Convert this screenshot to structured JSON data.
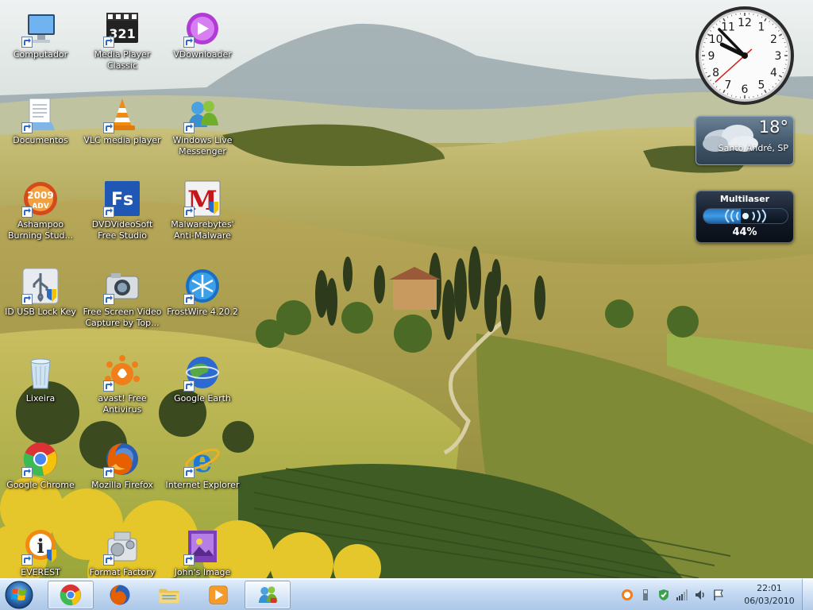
{
  "desktop": {
    "icons": [
      {
        "label": "Computador",
        "icon": "computer-icon"
      },
      {
        "label": "Media Player Classic",
        "icon": "media-player-classic-icon"
      },
      {
        "label": "VDownloader",
        "icon": "vdownloader-icon"
      },
      {
        "label": "Documentos",
        "icon": "documents-icon"
      },
      {
        "label": "VLC media player",
        "icon": "vlc-icon"
      },
      {
        "label": "Windows Live Messenger",
        "icon": "messenger-icon"
      },
      {
        "label": "Ashampoo Burning Stud...",
        "icon": "ashampoo-icon",
        "badge": "2009",
        "badge2": "ADV"
      },
      {
        "label": "DVDVideoSoft Free Studio",
        "icon": "dvdvideosoft-icon",
        "badge": "Fs"
      },
      {
        "label": "Malwarebytes' Anti-Malware",
        "icon": "malwarebytes-icon",
        "badge": "M"
      },
      {
        "label": "ID USB Lock Key",
        "icon": "usb-lock-icon"
      },
      {
        "label": "Free Screen Video Capture by Top...",
        "icon": "camera-icon"
      },
      {
        "label": "FrostWire 4.20.2",
        "icon": "frostwire-icon"
      },
      {
        "label": "Lixeira",
        "icon": "recycle-bin-icon"
      },
      {
        "label": "avast! Free Antivirus",
        "icon": "avast-icon"
      },
      {
        "label": "Google Earth",
        "icon": "google-earth-icon"
      },
      {
        "label": "Google Chrome",
        "icon": "chrome-icon"
      },
      {
        "label": "Mozilla Firefox",
        "icon": "firefox-icon"
      },
      {
        "label": "Internet Explorer",
        "icon": "internet-explorer-icon",
        "badge": "e"
      },
      {
        "label": "EVEREST Ultimate",
        "icon": "everest-icon",
        "badge": "i"
      },
      {
        "label": "Format Factory",
        "icon": "format-factory-icon"
      },
      {
        "label": "John's Image",
        "icon": "image-icon"
      }
    ]
  },
  "gadgets": {
    "clock": {
      "hour": 9,
      "minute": 52,
      "second": 38,
      "numerals": [
        "12",
        "1",
        "2",
        "3",
        "4",
        "5",
        "6",
        "7",
        "8",
        "9",
        "10",
        "11"
      ]
    },
    "weather": {
      "temperature": "18°",
      "city": "Santo André, SP"
    },
    "network": {
      "name": "Multilaser",
      "percent": "44%",
      "level": 0.44
    }
  },
  "taskbar": {
    "start_icon": "windows-logo-icon",
    "pinned": [
      "chrome-icon",
      "firefox-icon",
      "explorer-icon",
      "media-player-icon",
      "messenger-icon"
    ],
    "tray_icons": [
      "avast-tray-icon",
      "usb-tray-icon",
      "security-tray-icon",
      "signal-tray-icon",
      "volume-tray-icon",
      "action-center-flag-icon"
    ],
    "time": "22:01",
    "date": "06/03/2010"
  },
  "colors": {
    "taskbar": "#bcd4ef",
    "accent": "#3d9ce8"
  }
}
